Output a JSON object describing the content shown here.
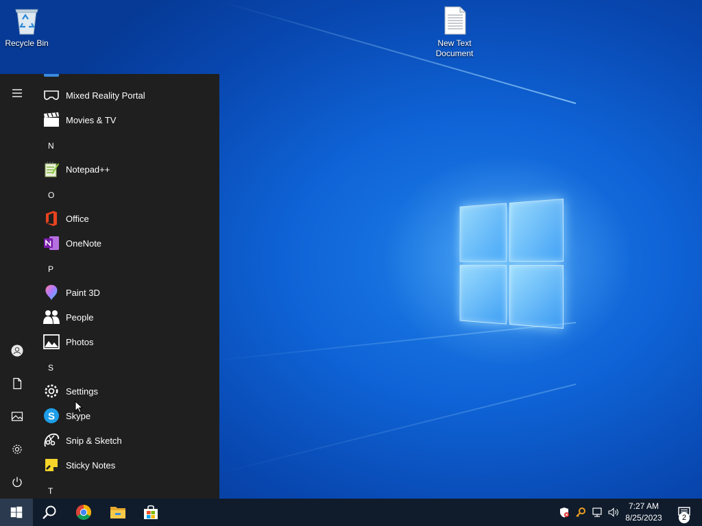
{
  "desktop": {
    "icons": [
      {
        "label": "Recycle Bin"
      },
      {
        "label": "New Text Document"
      }
    ]
  },
  "start_menu": {
    "rail": [
      "hamburger-menu",
      "user-account",
      "documents",
      "pictures",
      "settings",
      "power"
    ],
    "entries": [
      {
        "type": "app",
        "label": "Mixed Reality Portal",
        "icon": "mixed-reality-icon"
      },
      {
        "type": "app",
        "label": "Movies & TV",
        "icon": "movies-tv-icon"
      },
      {
        "type": "letter",
        "label": "N"
      },
      {
        "type": "app",
        "label": "Notepad++",
        "icon": "notepadpp-icon"
      },
      {
        "type": "letter",
        "label": "O"
      },
      {
        "type": "app",
        "label": "Office",
        "icon": "office-icon"
      },
      {
        "type": "app",
        "label": "OneNote",
        "icon": "onenote-icon"
      },
      {
        "type": "letter",
        "label": "P"
      },
      {
        "type": "app",
        "label": "Paint 3D",
        "icon": "paint3d-icon"
      },
      {
        "type": "app",
        "label": "People",
        "icon": "people-icon"
      },
      {
        "type": "app",
        "label": "Photos",
        "icon": "photos-icon"
      },
      {
        "type": "letter",
        "label": "S"
      },
      {
        "type": "app",
        "label": "Settings",
        "icon": "settings-icon"
      },
      {
        "type": "app",
        "label": "Skype",
        "icon": "skype-icon"
      },
      {
        "type": "app",
        "label": "Snip & Sketch",
        "icon": "snip-sketch-icon"
      },
      {
        "type": "app",
        "label": "Sticky Notes",
        "icon": "sticky-notes-icon"
      },
      {
        "type": "letter",
        "label": "T"
      }
    ]
  },
  "taskbar": {
    "pinned": [
      "start-button",
      "search-button",
      "chrome",
      "file-explorer",
      "microsoft-store"
    ],
    "tray": [
      "security-icon",
      "key-icon",
      "network-icon",
      "volume-icon"
    ],
    "clock": {
      "time": "7:27 AM",
      "date": "8/25/2023"
    },
    "notifications_count": "2"
  },
  "colors": {
    "start_bg": "#1f1f1f",
    "taskbar_bg": "#101c2c",
    "wallpaper_blue": "#0f63d6"
  }
}
